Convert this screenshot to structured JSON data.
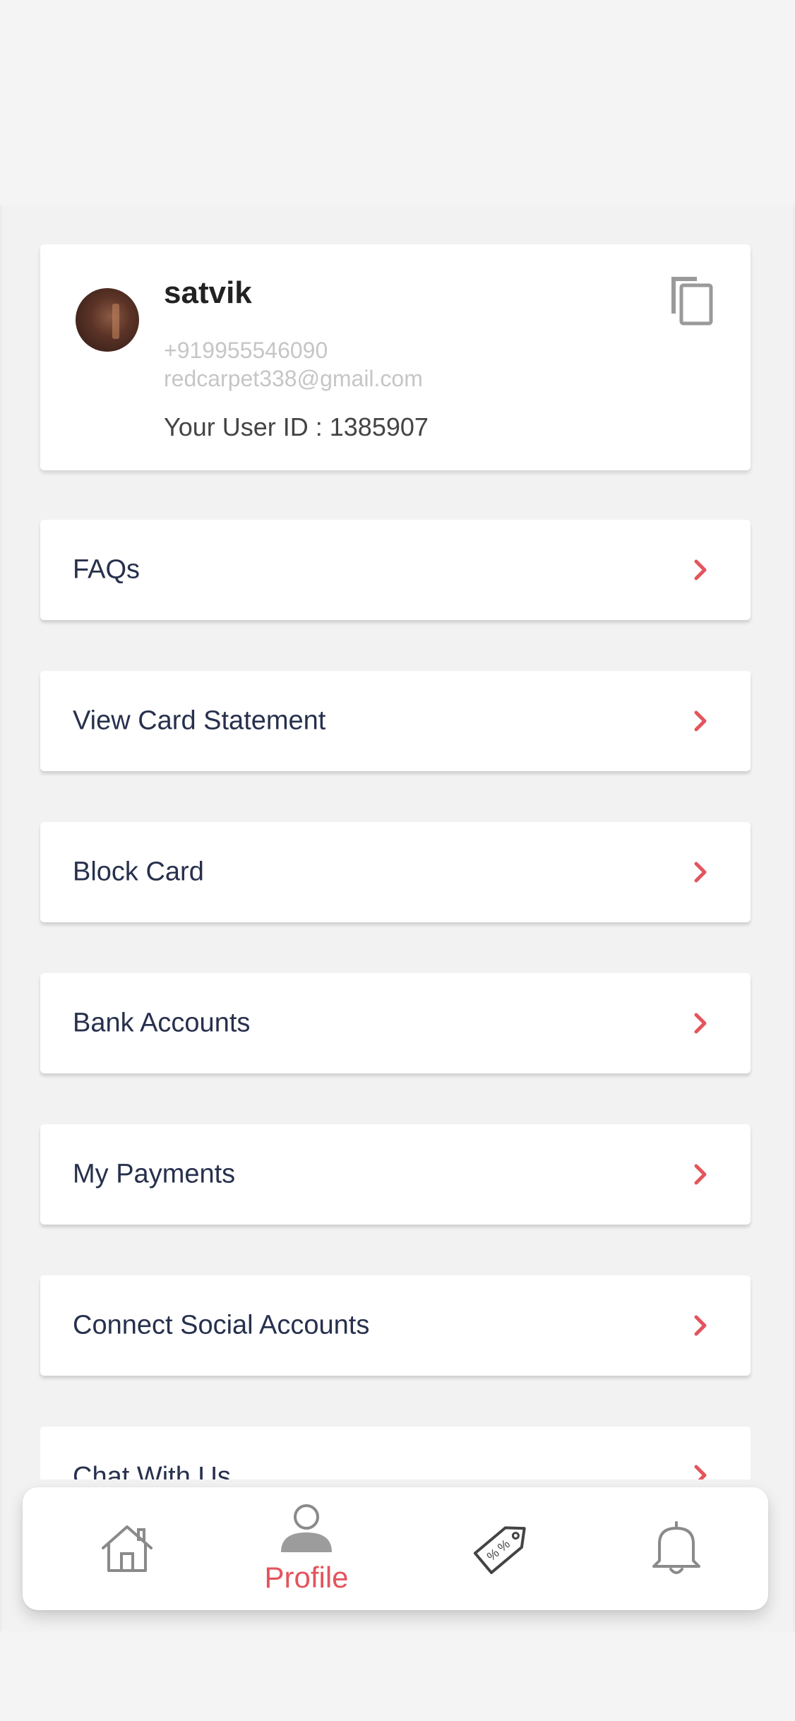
{
  "profile": {
    "name": "satvik",
    "phone": "+919955546090",
    "email": "redcarpet338@gmail.com",
    "user_id_label": "Your User ID : 1385907",
    "avatar_icon": "user-photo",
    "copy_icon": "copy-icon"
  },
  "menu": {
    "items": [
      {
        "label": "FAQs"
      },
      {
        "label": "View Card Statement"
      },
      {
        "label": "Block Card"
      },
      {
        "label": "Bank Accounts"
      },
      {
        "label": "My Payments"
      },
      {
        "label": "Connect Social Accounts"
      },
      {
        "label": "Chat With Us"
      }
    ],
    "chevron_icon": "chevron-right-icon",
    "chevron_color": "#e4545c"
  },
  "bottom_nav": {
    "items": [
      {
        "icon": "home-icon",
        "label": ""
      },
      {
        "icon": "profile-icon",
        "label": "Profile",
        "active": true
      },
      {
        "icon": "offers-tag-icon",
        "label": ""
      },
      {
        "icon": "bell-icon",
        "label": ""
      }
    ],
    "active_color": "#e4545c"
  }
}
